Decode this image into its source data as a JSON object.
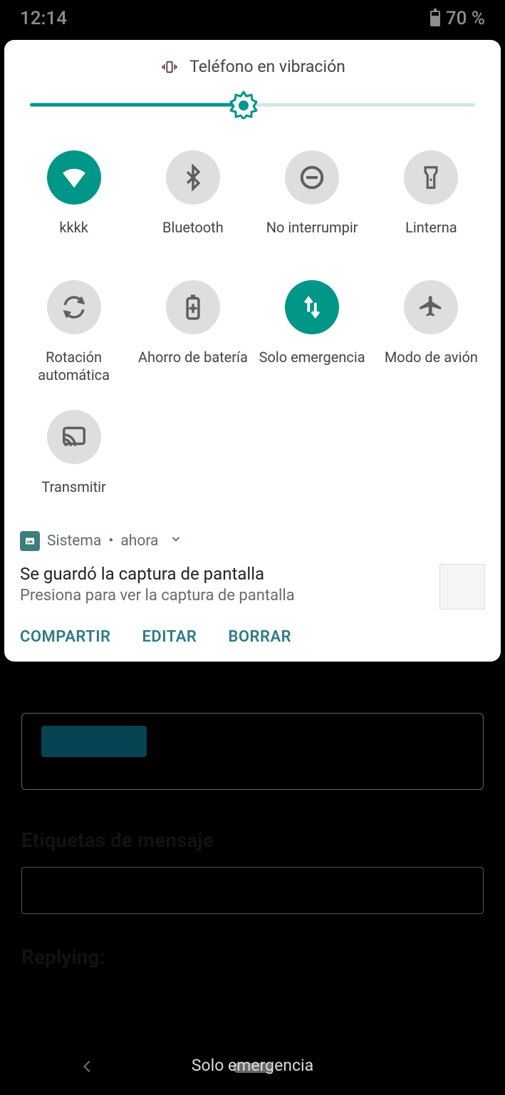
{
  "status": {
    "time": "12:14",
    "battery": "70 %"
  },
  "ringer": {
    "label": "Teléfono en vibración"
  },
  "brightness": {
    "percent": 48
  },
  "tiles": [
    {
      "id": "wifi",
      "label": "kkkk",
      "active": true
    },
    {
      "id": "bluetooth",
      "label": "Bluetooth",
      "active": false
    },
    {
      "id": "dnd",
      "label": "No interrumpir",
      "active": false
    },
    {
      "id": "flashlight",
      "label": "Linterna",
      "active": false
    },
    {
      "id": "autorotate",
      "label": "Rotación automática",
      "active": false
    },
    {
      "id": "battery",
      "label": "Ahorro de batería",
      "active": false
    },
    {
      "id": "emergency",
      "label": "Solo emergencia",
      "active": true
    },
    {
      "id": "airplane",
      "label": "Modo de avión",
      "active": false
    },
    {
      "id": "cast",
      "label": "Transmitir",
      "active": false
    }
  ],
  "notification": {
    "app": "Sistema",
    "time": "ahora",
    "title": "Se guardó la captura de pantalla",
    "subtitle": "Presiona para ver la captura de pantalla",
    "actions": {
      "share": "COMPARTIR",
      "edit": "EDITAR",
      "delete": "BORRAR"
    }
  },
  "background": {
    "label_tags": "Etiquetas de mensaje",
    "label_reply": "Replying:"
  },
  "bottom": {
    "emergency": "Solo emergencia"
  }
}
